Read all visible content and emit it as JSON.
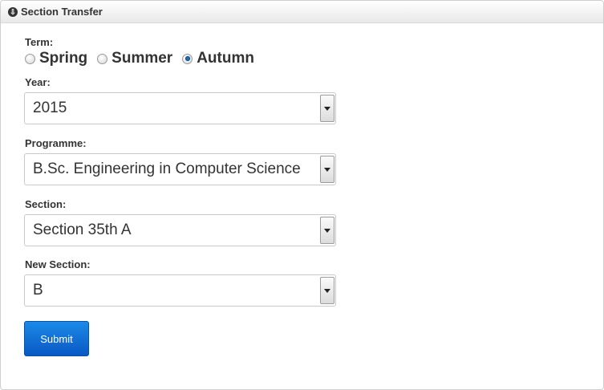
{
  "panel": {
    "title": "Section Transfer"
  },
  "term": {
    "label": "Term:",
    "options": [
      {
        "label": "Spring",
        "checked": false
      },
      {
        "label": "Summer",
        "checked": false
      },
      {
        "label": "Autumn",
        "checked": true
      }
    ]
  },
  "year": {
    "label": "Year:",
    "value": "2015"
  },
  "programme": {
    "label": "Programme:",
    "value": "B.Sc. Engineering in Computer Science"
  },
  "section": {
    "label": "Section:",
    "value": "Section 35th A"
  },
  "new_section": {
    "label": "New Section:",
    "value": "B"
  },
  "submit": {
    "label": "Submit"
  },
  "colors": {
    "accent": "#0a58c4",
    "radio_checked": "#1a6fb0"
  }
}
